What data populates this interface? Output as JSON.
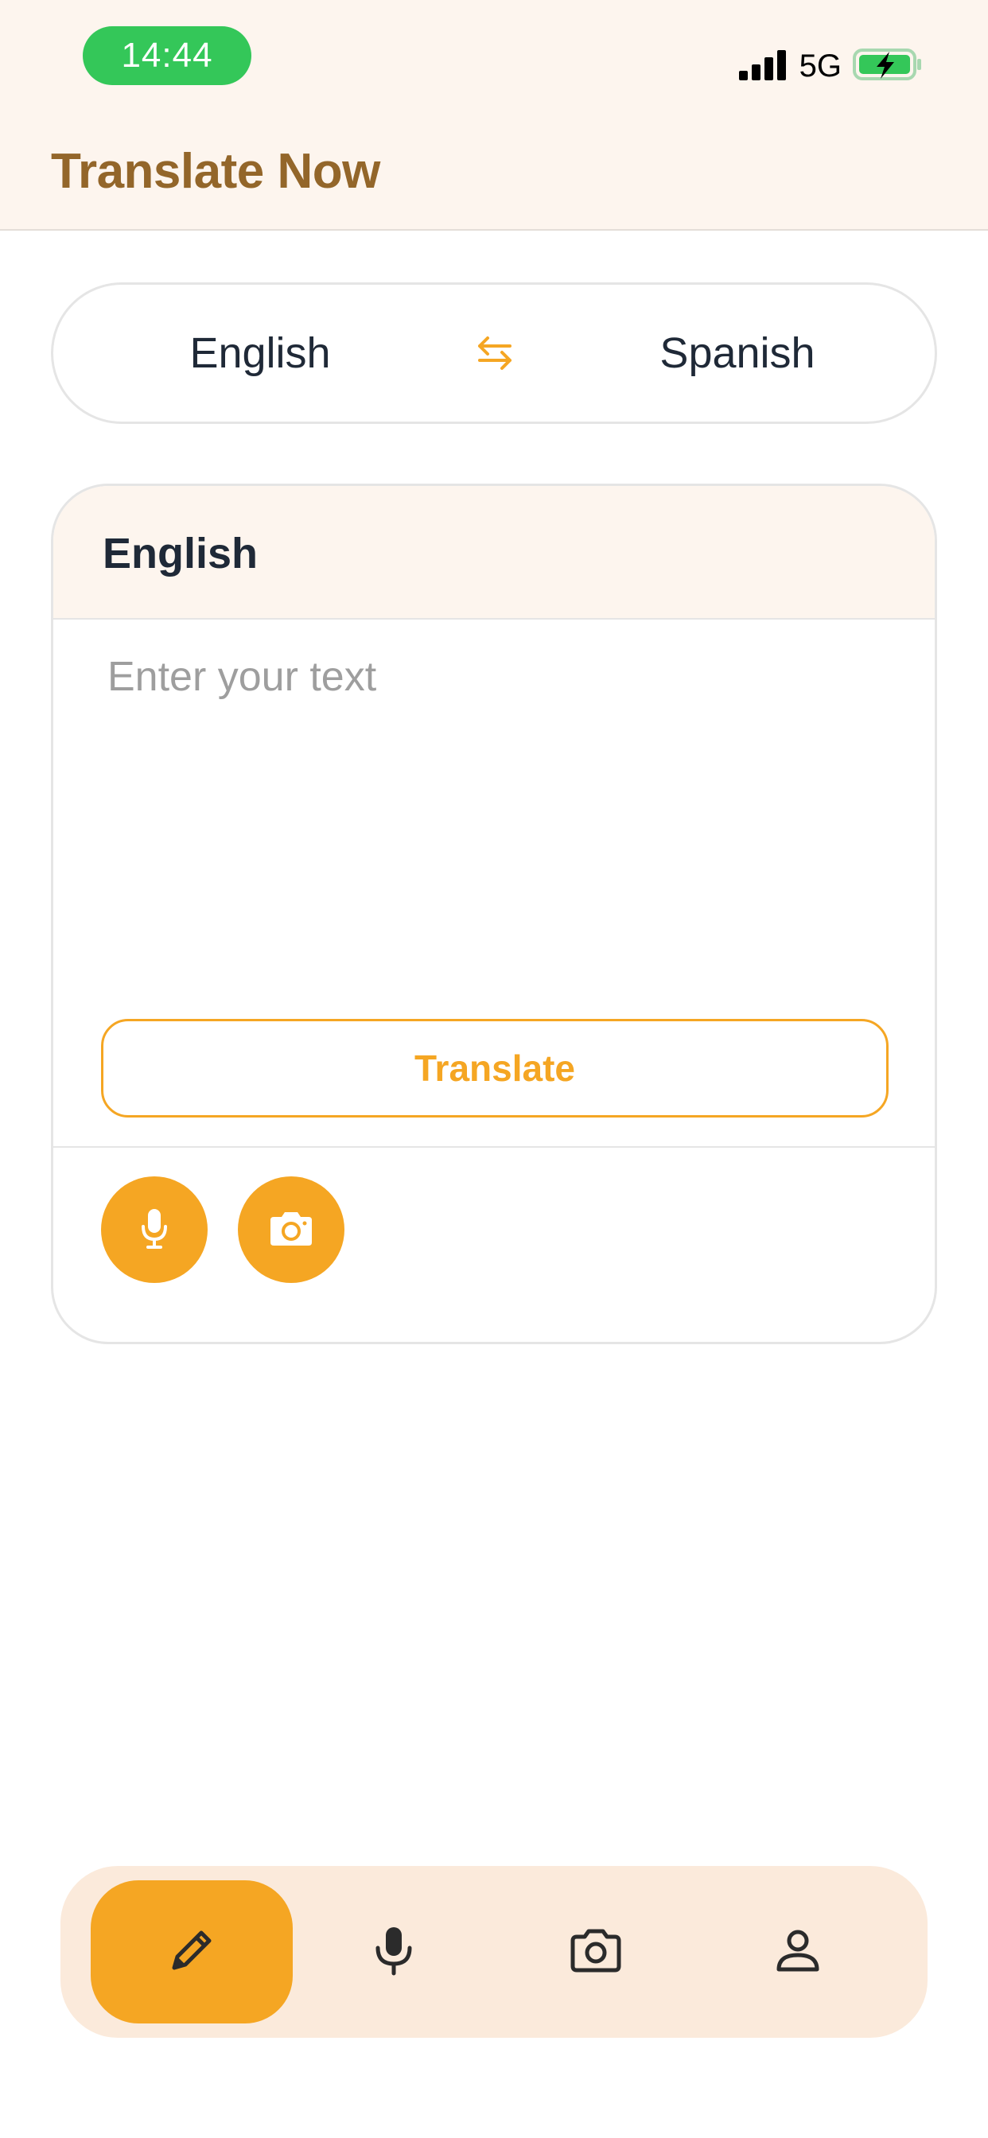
{
  "status_bar": {
    "time": "14:44",
    "network": "5G",
    "signal_icon": "signal-bars-icon",
    "battery_icon": "battery-charging-icon",
    "time_pill_color": "#34c759"
  },
  "header": {
    "title": "Translate Now",
    "title_color": "#93662a"
  },
  "language_selector": {
    "source": "English",
    "target": "Spanish",
    "swap_icon": "swap-arrows-icon"
  },
  "input_card": {
    "language_label": "English",
    "placeholder": "Enter your text",
    "value": "",
    "translate_label": "Translate",
    "actions": [
      {
        "name": "microphone-button",
        "icon": "microphone-icon"
      },
      {
        "name": "camera-button",
        "icon": "camera-icon"
      }
    ]
  },
  "tab_bar": {
    "active_index": 0,
    "items": [
      {
        "name": "tab-text",
        "icon": "pencil-icon"
      },
      {
        "name": "tab-voice",
        "icon": "microphone-icon"
      },
      {
        "name": "tab-camera",
        "icon": "camera-icon"
      },
      {
        "name": "tab-profile",
        "icon": "person-icon"
      }
    ]
  },
  "colors": {
    "accent": "#f5a623",
    "header_bg": "#fdf5ee",
    "tab_bar_bg": "#fbeadb",
    "text_primary": "#1f2937"
  }
}
